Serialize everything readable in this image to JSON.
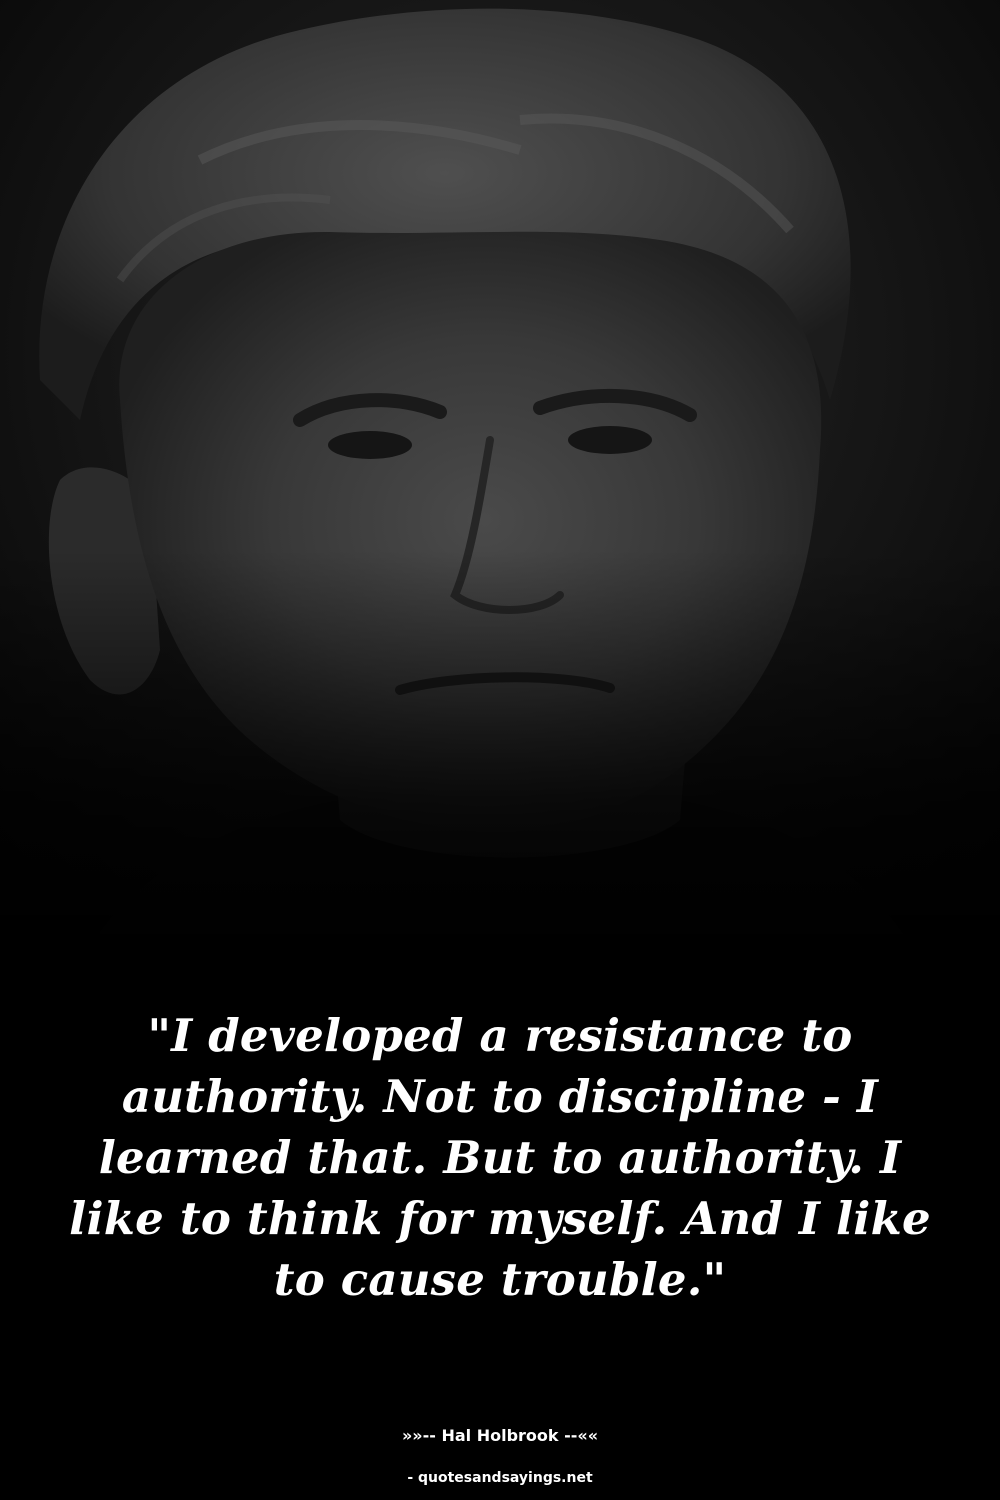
{
  "quote": {
    "text": "\"I developed a resistance to authority. Not to discipline - I learned that. But to authority. I like to think for myself. And I like to cause trouble.\""
  },
  "attribution": {
    "author_line": "»»-- Hal Holbrook --««"
  },
  "source": {
    "text": "- quotesandsayings.net"
  },
  "colors": {
    "background": "#000000",
    "text": "#ffffff"
  }
}
